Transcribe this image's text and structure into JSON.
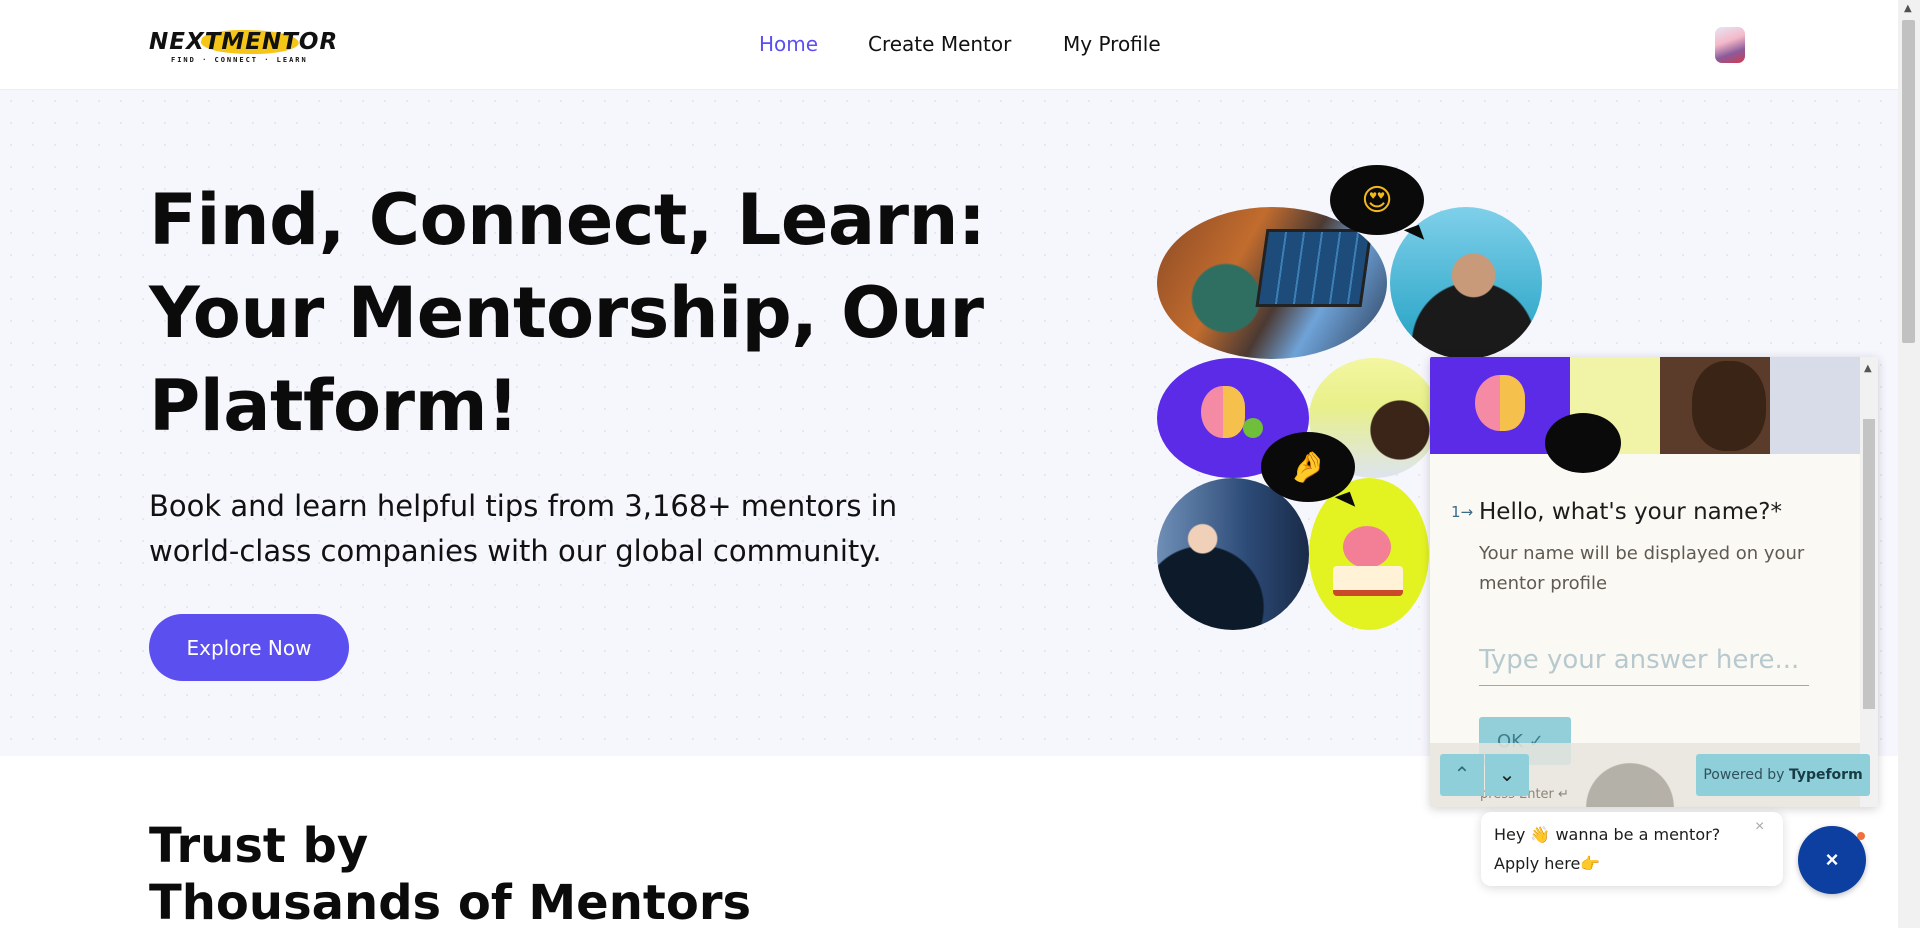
{
  "header": {
    "logo_text": "NEXTMENTOR",
    "logo_tagline": "FIND · CONNECT · LEARN",
    "nav": [
      {
        "label": "Home",
        "active": true
      },
      {
        "label": "Create Mentor",
        "active": false
      },
      {
        "label": "My Profile",
        "active": false
      }
    ]
  },
  "hero": {
    "title": "Find, Connect, Learn: Your Mentorship, Our Platform!",
    "subtitle": "Book and learn helpful tips from 3,168+ mentors in world-class companies with our global community.",
    "cta_label": "Explore Now",
    "bubble_emojis": [
      "😍",
      "🤌"
    ]
  },
  "typeform": {
    "question_number": "1→",
    "question": "Hello, what's your name?*",
    "description": "Your name will be displayed on your mentor profile",
    "input_placeholder": "Type your answer here...",
    "ok_label": "OK ✓",
    "press_enter": "press Enter ↵",
    "powered_by": "Powered by",
    "powered_brand": "Typeform",
    "nav_up": "⌃",
    "nav_down": "⌄"
  },
  "chat": {
    "message_line1": "Hey 👋 wanna be a mentor?",
    "message_line2": "Apply here👉",
    "close": "×",
    "fab_icon": "×"
  },
  "section2": {
    "title_line1": "Trust by",
    "title_line2": "Thousands of Mentors"
  },
  "colors": {
    "accent": "#5c4ff0",
    "hero_bg": "#f6f6fd",
    "typeform_button": "#8fcfda",
    "fab": "#0c3fa0"
  }
}
